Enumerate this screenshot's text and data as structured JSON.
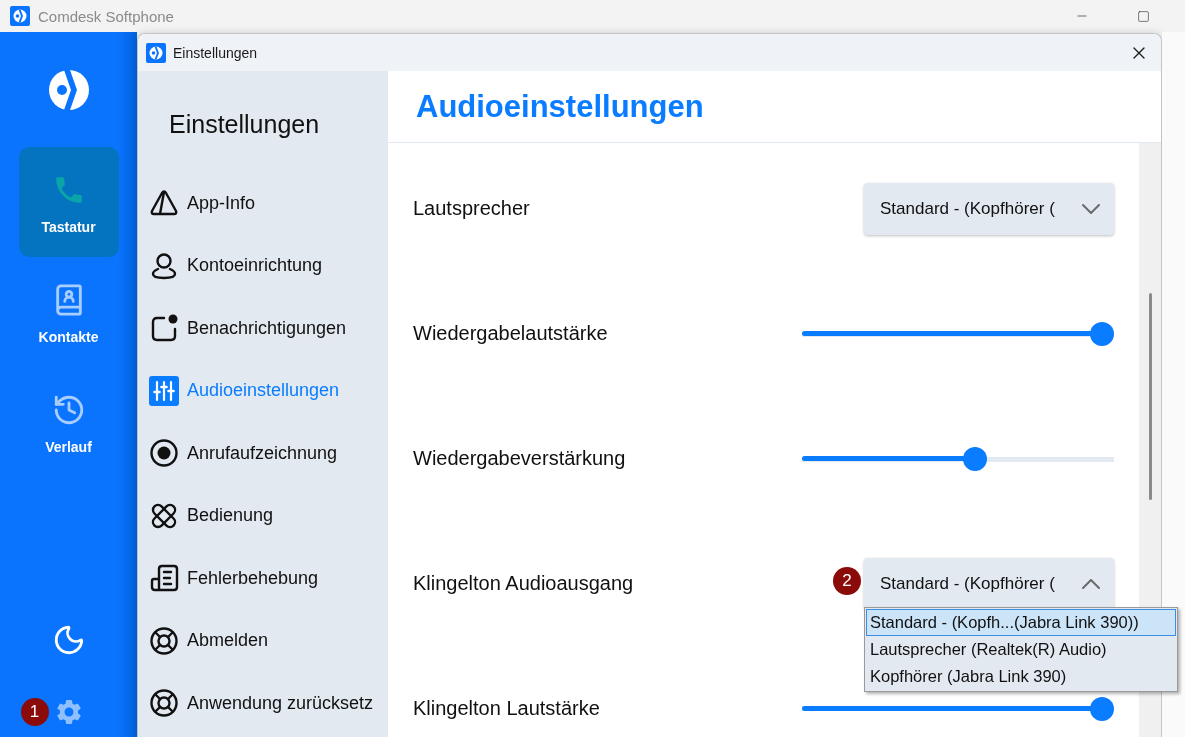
{
  "window": {
    "title": "Comdesk Softphone"
  },
  "app_sidebar": {
    "items": [
      {
        "label": "Tastatur",
        "selected": true
      },
      {
        "label": "Kontakte",
        "selected": false
      },
      {
        "label": "Verlauf",
        "selected": false
      }
    ],
    "settings_marker": "1"
  },
  "dialog": {
    "title": "Einstellungen",
    "nav": {
      "heading": "Einstellungen",
      "items": [
        {
          "label": "App-Info",
          "selected": false
        },
        {
          "label": "Kontoeinrichtung",
          "selected": false
        },
        {
          "label": "Benachrichtigungen",
          "selected": false
        },
        {
          "label": "Audioeinstellungen",
          "selected": true
        },
        {
          "label": "Anrufaufzeichnung",
          "selected": false
        },
        {
          "label": "Bedienung",
          "selected": false
        },
        {
          "label": "Fehlerbehebung",
          "selected": false
        },
        {
          "label": "Abmelden",
          "selected": false
        },
        {
          "label": "Anwendung zurücksetz",
          "selected": false
        }
      ]
    },
    "page": {
      "title": "Audioeinstellungen",
      "settings": [
        {
          "kind": "select",
          "label": "Lautsprecher",
          "value": "Standard - (Kopfhörer (",
          "expanded": false
        },
        {
          "kind": "slider",
          "label": "Wiedergabelautstärke",
          "level": 1
        },
        {
          "kind": "slider",
          "label": "Wiedergabeverstärkung",
          "level": 0.56
        },
        {
          "kind": "select",
          "label": "Klingelton Audioausgang",
          "value": "Standard - (Kopfhörer (",
          "expanded": true,
          "marker": "2",
          "options": [
            {
              "label": "Standard - (Kopfh...(Jabra Link 390))",
              "selected": true
            },
            {
              "label": "Lautsprecher (Realtek(R) Audio)",
              "selected": false
            },
            {
              "label": "Kopfhörer (Jabra Link 390)",
              "selected": false
            }
          ]
        },
        {
          "kind": "slider",
          "label": "Klingelton Lautstärke",
          "level": 1
        }
      ]
    }
  }
}
